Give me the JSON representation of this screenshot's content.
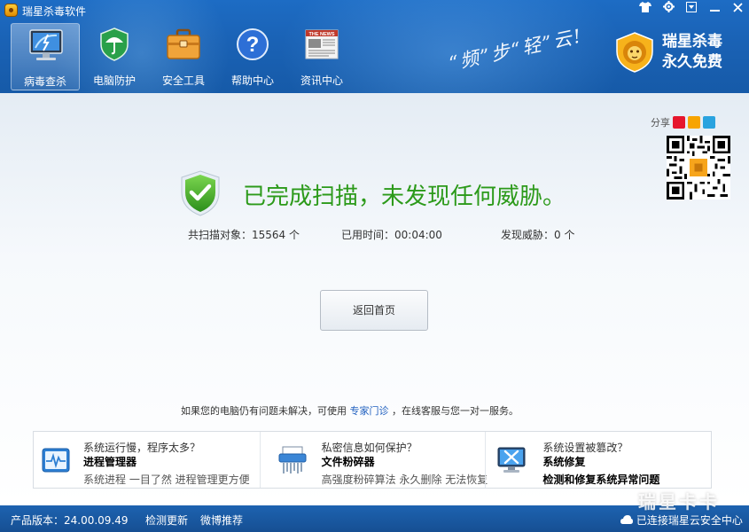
{
  "window": {
    "title": "瑞星杀毒软件",
    "controls": [
      "skin-icon",
      "settings-icon",
      "menu-icon",
      "minimize-icon",
      "close-icon"
    ]
  },
  "tabs": [
    {
      "label": "病毒查杀",
      "icon": "virus-scan-icon",
      "active": true
    },
    {
      "label": "电脑防护",
      "icon": "protection-icon",
      "active": false
    },
    {
      "label": "安全工具",
      "icon": "toolbox-icon",
      "active": false
    },
    {
      "label": "帮助中心",
      "icon": "help-icon",
      "active": false
    },
    {
      "label": "资讯中心",
      "icon": "news-icon",
      "active": false
    }
  ],
  "news_icon_text": "THE NEWS",
  "slogan": "“频”步“轻”云!",
  "brand": {
    "line1": "瑞星杀毒",
    "line2": "永久免费"
  },
  "share": {
    "label": "分享"
  },
  "result": {
    "headline": "已完成扫描，未发现任何威胁。",
    "stats": [
      {
        "label": "共扫描对象：15564  个"
      },
      {
        "label": "已用时间：00:04:00"
      },
      {
        "label": "发现威胁：0  个"
      }
    ]
  },
  "back_button": "返回首页",
  "help": {
    "before": "如果您的电脑仍有问题未解决，可使用",
    "link": "专家门诊",
    "after": "，在线客服与您一对一服务。"
  },
  "cards": [
    {
      "question": "系统运行慢，程序太多？",
      "title": "进程管理器",
      "desc": "系统进程 一目了然 进程管理更方便",
      "icon": "process-manager-icon"
    },
    {
      "question": "私密信息如何保护？",
      "title": "文件粉碎器",
      "desc": "高强度粉碎算法 永久删除 无法恢复",
      "icon": "file-shredder-icon"
    },
    {
      "question": "系统设置被篡改？",
      "title": "系统修复",
      "desc": "检测和修复系统异常问题",
      "icon": "system-repair-icon"
    }
  ],
  "footer": {
    "version": "产品版本：24.00.09.49",
    "update": "检测更新",
    "weibo": "微博推荐",
    "cloud_status": "已连接瑞星云安全中心"
  },
  "watermark": "瑞星卡卡",
  "colors": {
    "accent": "#1d6cc4",
    "success": "#2c9a1a",
    "link": "#1f5fbf"
  }
}
